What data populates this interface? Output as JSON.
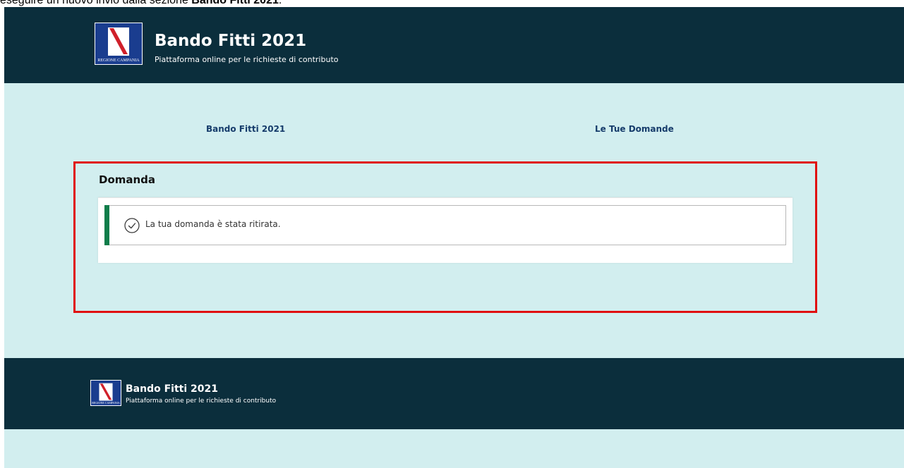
{
  "doc_text": {
    "prefix": "eseguire un nuovo invio dalla sezione ",
    "bold": "Bando Fitti 2021",
    "suffix": "."
  },
  "header": {
    "logo_text": "REGIONE CAMPANIA",
    "title": "Bando Fitti 2021",
    "subtitle": "Piattaforma online per le richieste di contributo"
  },
  "nav": {
    "items": [
      {
        "label": "Bando Fitti 2021"
      },
      {
        "label": "Le Tue Domande"
      }
    ]
  },
  "main": {
    "section_title": "Domanda",
    "alert": {
      "icon": "check-circle-icon",
      "message": "La tua domanda è stata ritirata."
    }
  },
  "footer": {
    "logo_text": "REGIONE CAMPANIA",
    "title": "Bando Fitti 2021",
    "subtitle": "Piattaforma online per le richieste di contributo"
  },
  "colors": {
    "header_bg": "#0b2e3c",
    "page_bg": "#d2eeef",
    "nav_link": "#163c6b",
    "alert_accent": "#0f7d4a",
    "highlight_border": "#e01010"
  }
}
